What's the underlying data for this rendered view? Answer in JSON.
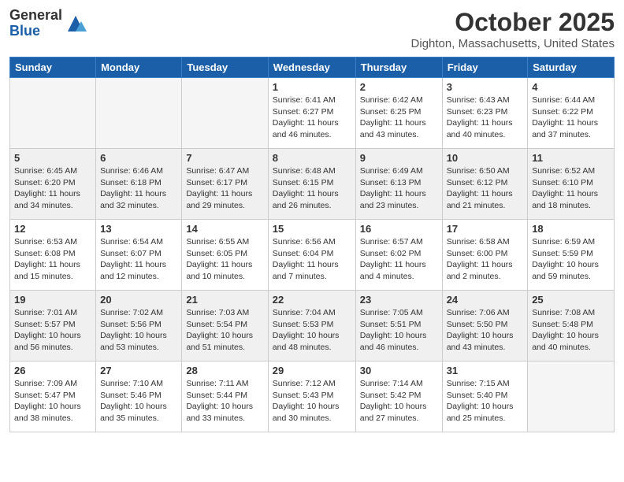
{
  "header": {
    "logo_general": "General",
    "logo_blue": "Blue",
    "month": "October 2025",
    "location": "Dighton, Massachusetts, United States"
  },
  "days_of_week": [
    "Sunday",
    "Monday",
    "Tuesday",
    "Wednesday",
    "Thursday",
    "Friday",
    "Saturday"
  ],
  "weeks": [
    [
      {
        "day": "",
        "info": ""
      },
      {
        "day": "",
        "info": ""
      },
      {
        "day": "",
        "info": ""
      },
      {
        "day": "1",
        "info": "Sunrise: 6:41 AM\nSunset: 6:27 PM\nDaylight: 11 hours\nand 46 minutes."
      },
      {
        "day": "2",
        "info": "Sunrise: 6:42 AM\nSunset: 6:25 PM\nDaylight: 11 hours\nand 43 minutes."
      },
      {
        "day": "3",
        "info": "Sunrise: 6:43 AM\nSunset: 6:23 PM\nDaylight: 11 hours\nand 40 minutes."
      },
      {
        "day": "4",
        "info": "Sunrise: 6:44 AM\nSunset: 6:22 PM\nDaylight: 11 hours\nand 37 minutes."
      }
    ],
    [
      {
        "day": "5",
        "info": "Sunrise: 6:45 AM\nSunset: 6:20 PM\nDaylight: 11 hours\nand 34 minutes."
      },
      {
        "day": "6",
        "info": "Sunrise: 6:46 AM\nSunset: 6:18 PM\nDaylight: 11 hours\nand 32 minutes."
      },
      {
        "day": "7",
        "info": "Sunrise: 6:47 AM\nSunset: 6:17 PM\nDaylight: 11 hours\nand 29 minutes."
      },
      {
        "day": "8",
        "info": "Sunrise: 6:48 AM\nSunset: 6:15 PM\nDaylight: 11 hours\nand 26 minutes."
      },
      {
        "day": "9",
        "info": "Sunrise: 6:49 AM\nSunset: 6:13 PM\nDaylight: 11 hours\nand 23 minutes."
      },
      {
        "day": "10",
        "info": "Sunrise: 6:50 AM\nSunset: 6:12 PM\nDaylight: 11 hours\nand 21 minutes."
      },
      {
        "day": "11",
        "info": "Sunrise: 6:52 AM\nSunset: 6:10 PM\nDaylight: 11 hours\nand 18 minutes."
      }
    ],
    [
      {
        "day": "12",
        "info": "Sunrise: 6:53 AM\nSunset: 6:08 PM\nDaylight: 11 hours\nand 15 minutes."
      },
      {
        "day": "13",
        "info": "Sunrise: 6:54 AM\nSunset: 6:07 PM\nDaylight: 11 hours\nand 12 minutes."
      },
      {
        "day": "14",
        "info": "Sunrise: 6:55 AM\nSunset: 6:05 PM\nDaylight: 11 hours\nand 10 minutes."
      },
      {
        "day": "15",
        "info": "Sunrise: 6:56 AM\nSunset: 6:04 PM\nDaylight: 11 hours\nand 7 minutes."
      },
      {
        "day": "16",
        "info": "Sunrise: 6:57 AM\nSunset: 6:02 PM\nDaylight: 11 hours\nand 4 minutes."
      },
      {
        "day": "17",
        "info": "Sunrise: 6:58 AM\nSunset: 6:00 PM\nDaylight: 11 hours\nand 2 minutes."
      },
      {
        "day": "18",
        "info": "Sunrise: 6:59 AM\nSunset: 5:59 PM\nDaylight: 10 hours\nand 59 minutes."
      }
    ],
    [
      {
        "day": "19",
        "info": "Sunrise: 7:01 AM\nSunset: 5:57 PM\nDaylight: 10 hours\nand 56 minutes."
      },
      {
        "day": "20",
        "info": "Sunrise: 7:02 AM\nSunset: 5:56 PM\nDaylight: 10 hours\nand 53 minutes."
      },
      {
        "day": "21",
        "info": "Sunrise: 7:03 AM\nSunset: 5:54 PM\nDaylight: 10 hours\nand 51 minutes."
      },
      {
        "day": "22",
        "info": "Sunrise: 7:04 AM\nSunset: 5:53 PM\nDaylight: 10 hours\nand 48 minutes."
      },
      {
        "day": "23",
        "info": "Sunrise: 7:05 AM\nSunset: 5:51 PM\nDaylight: 10 hours\nand 46 minutes."
      },
      {
        "day": "24",
        "info": "Sunrise: 7:06 AM\nSunset: 5:50 PM\nDaylight: 10 hours\nand 43 minutes."
      },
      {
        "day": "25",
        "info": "Sunrise: 7:08 AM\nSunset: 5:48 PM\nDaylight: 10 hours\nand 40 minutes."
      }
    ],
    [
      {
        "day": "26",
        "info": "Sunrise: 7:09 AM\nSunset: 5:47 PM\nDaylight: 10 hours\nand 38 minutes."
      },
      {
        "day": "27",
        "info": "Sunrise: 7:10 AM\nSunset: 5:46 PM\nDaylight: 10 hours\nand 35 minutes."
      },
      {
        "day": "28",
        "info": "Sunrise: 7:11 AM\nSunset: 5:44 PM\nDaylight: 10 hours\nand 33 minutes."
      },
      {
        "day": "29",
        "info": "Sunrise: 7:12 AM\nSunset: 5:43 PM\nDaylight: 10 hours\nand 30 minutes."
      },
      {
        "day": "30",
        "info": "Sunrise: 7:14 AM\nSunset: 5:42 PM\nDaylight: 10 hours\nand 27 minutes."
      },
      {
        "day": "31",
        "info": "Sunrise: 7:15 AM\nSunset: 5:40 PM\nDaylight: 10 hours\nand 25 minutes."
      },
      {
        "day": "",
        "info": ""
      }
    ]
  ]
}
